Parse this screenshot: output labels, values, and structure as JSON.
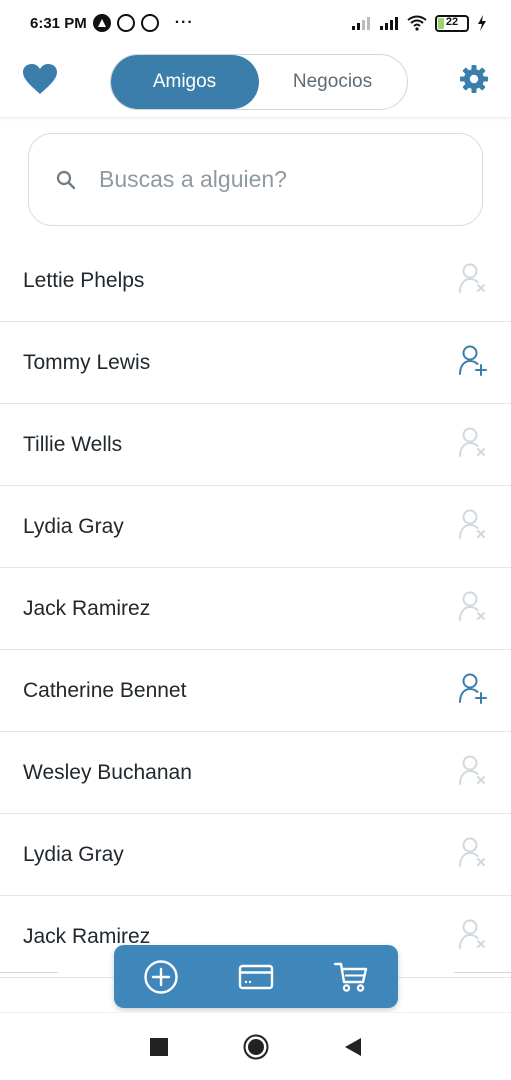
{
  "status_bar": {
    "time": "6:31 PM",
    "dots": "···",
    "battery_level": "22",
    "battery_fraction": 0.22
  },
  "header": {
    "tabs": [
      {
        "label": "Amigos",
        "active": true
      },
      {
        "label": "Negocios",
        "active": false
      }
    ],
    "accent_color": "#3c7eab"
  },
  "search": {
    "placeholder": "Buscas a alguien?",
    "value": ""
  },
  "contacts": [
    {
      "name": "Lettie Phelps",
      "status": "remove",
      "icon": "user-remove-icon"
    },
    {
      "name": "Tommy Lewis",
      "status": "add",
      "icon": "user-add-icon"
    },
    {
      "name": "Tillie Wells",
      "status": "remove",
      "icon": "user-remove-icon"
    },
    {
      "name": "Lydia Gray",
      "status": "remove",
      "icon": "user-remove-icon"
    },
    {
      "name": "Jack Ramirez",
      "status": "remove",
      "icon": "user-remove-icon"
    },
    {
      "name": "Catherine Bennet",
      "status": "add",
      "icon": "user-add-icon"
    },
    {
      "name": "Wesley Buchanan",
      "status": "remove",
      "icon": "user-remove-icon"
    },
    {
      "name": "Lydia Gray",
      "status": "remove",
      "icon": "user-remove-icon"
    },
    {
      "name": "Jack Ramirez",
      "status": "remove",
      "icon": "user-remove-icon"
    }
  ],
  "bottom_bar": {
    "icons": [
      "plus-circle-icon",
      "card-icon",
      "cart-icon"
    ],
    "color": "#3f87ba"
  },
  "nav_bar": {
    "icons": [
      "recents-square-icon",
      "home-circle-icon",
      "back-triangle-icon"
    ]
  }
}
